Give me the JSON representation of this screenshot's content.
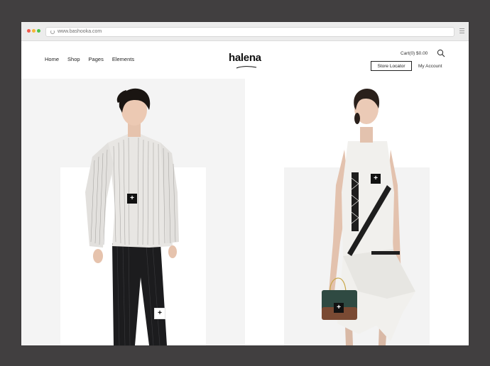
{
  "browser": {
    "url": "www.bashooka.com"
  },
  "header": {
    "nav": [
      "Home",
      "Shop",
      "Pages",
      "Elements"
    ],
    "logo": "halena",
    "cart": "Cart(0) $0.00",
    "store_locator": "Store Locator",
    "my_account": "My Account"
  },
  "products": {
    "hotspot_symbol": "+"
  },
  "colors": {
    "background": "#413f40",
    "hotspot_dark": "#111111",
    "hotspot_light": "#ffffff"
  },
  "icons": [
    "reload-icon",
    "browser-menu-icon",
    "search-icon",
    "plus-icon"
  ]
}
